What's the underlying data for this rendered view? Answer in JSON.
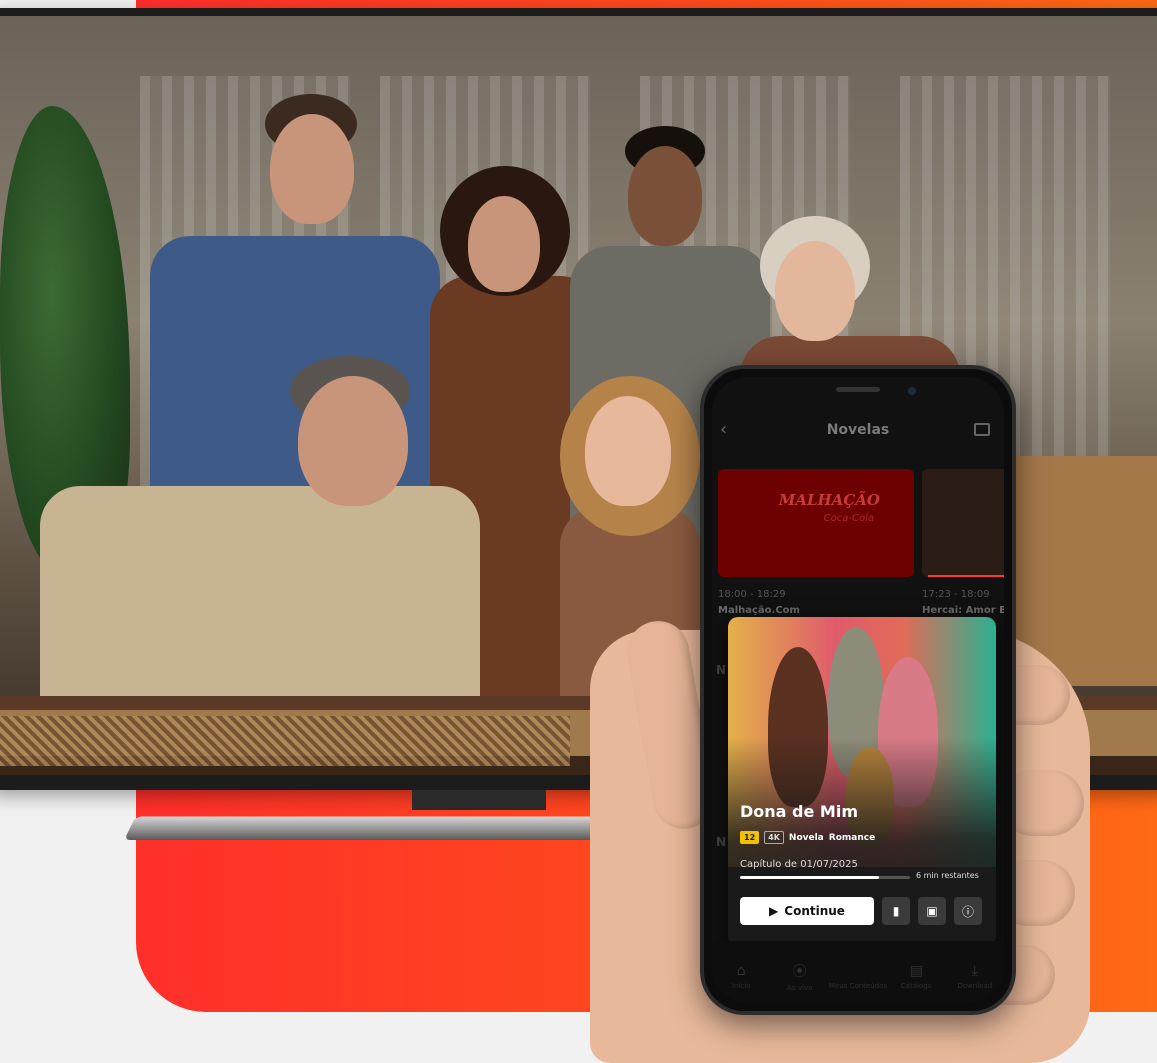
{
  "app": {
    "header_title": "Novelas",
    "icons": {
      "back": "chevron-left-icon",
      "cast": "cast-icon",
      "close": "close-icon",
      "play": "play-icon",
      "episodes": "episodes-icon",
      "save": "bookmark-icon",
      "info": "info-icon"
    }
  },
  "schedule": [
    {
      "time": "18:00 - 18:29",
      "name": "Malhação.Com",
      "logo": "MALHAÇÃO",
      "logo_sub": "Coca-Cola"
    },
    {
      "time": "17:23 - 18:09",
      "name": "Hercai: Amor E V"
    }
  ],
  "featured": {
    "title": "Dona de Mim",
    "age_rating": "12",
    "quality": "4K",
    "genres": [
      "Novela",
      "Romance"
    ],
    "episode": "Capítulo de 01/07/2025",
    "progress_fraction": 0.82,
    "remaining": "6 min restantes",
    "continue_label": "Continue",
    "side_letter": "N"
  },
  "nav": [
    {
      "label": "Início",
      "icon": "home-icon"
    },
    {
      "label": "Ao vivo",
      "icon": "live-icon"
    },
    {
      "label": "Meus Conteúdos",
      "icon": "my-content-icon"
    },
    {
      "label": "Catálogo",
      "icon": "catalog-icon"
    },
    {
      "label": "Download",
      "icon": "download-icon"
    }
  ],
  "colors": {
    "brand_gradient_start": "#ff2f2a",
    "brand_gradient_end": "#ff6a14",
    "age_badge": "#f2c200",
    "progress_bar": "#ff3a2a"
  }
}
